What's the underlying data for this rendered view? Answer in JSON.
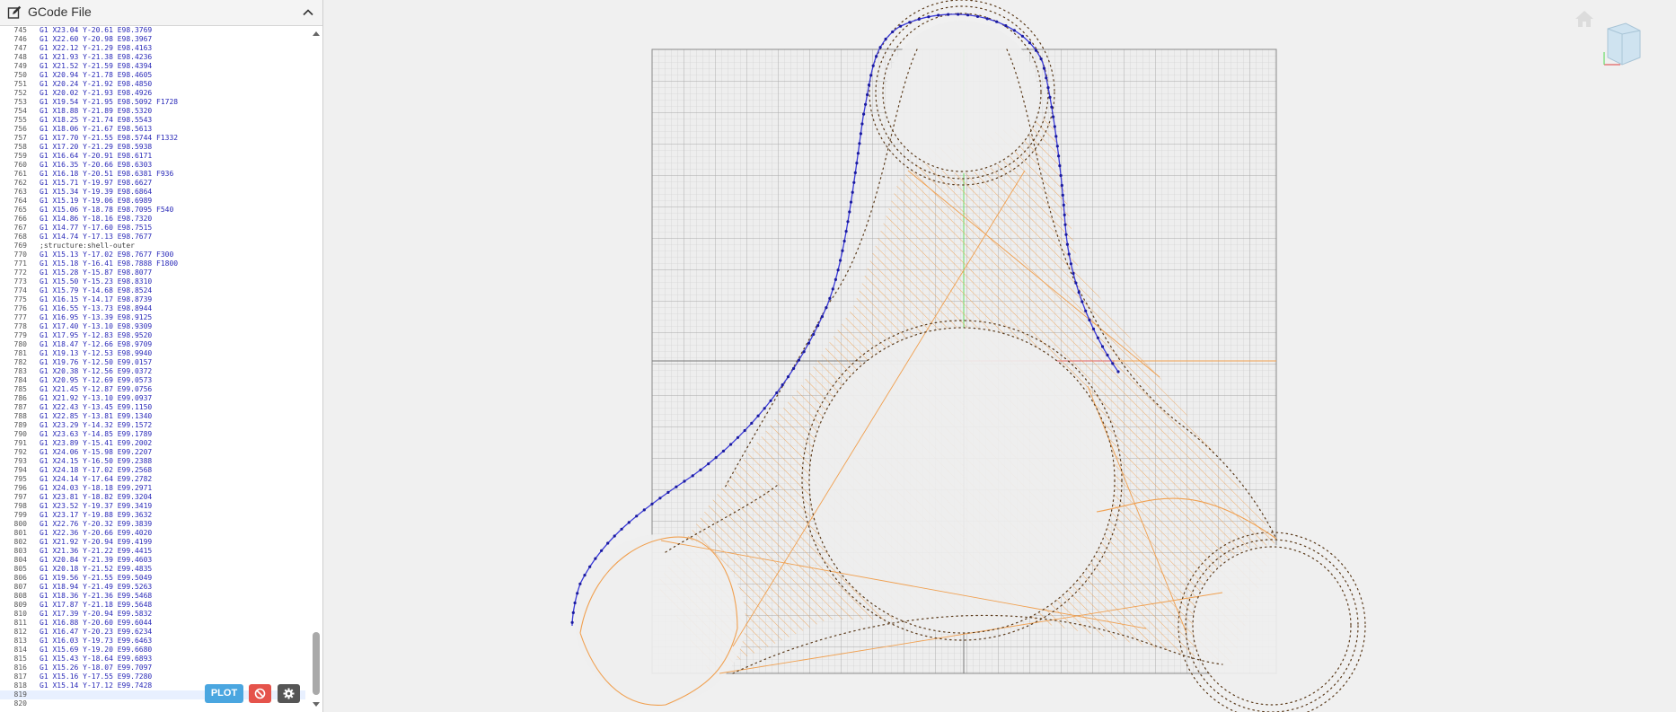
{
  "panel": {
    "title": "GCode File"
  },
  "buttons": {
    "plot_label": "PLOT"
  },
  "icons": {
    "edit": "edit-icon",
    "collapse": "chevron-up-icon",
    "stop": "ban-icon",
    "settings": "gear-icon",
    "home": "home-icon",
    "cube": "view-cube-icon"
  },
  "colors": {
    "gcode_text": "#2a2ab8",
    "plot_button": "#4aa6e0",
    "stop_button": "#e5534b",
    "settings_button": "#555555",
    "travel_path": "#3a3ad8",
    "infill": "#f0a050",
    "grid": "#c8c8c8",
    "y_axis": "#66dd66",
    "x_axis": "#e06060"
  },
  "gcode_lines": [
    {
      "n": "745",
      "t": "G1 X23.04 Y-20.61 E98.3769"
    },
    {
      "n": "746",
      "t": "G1 X22.60 Y-20.98 E98.3967"
    },
    {
      "n": "747",
      "t": "G1 X22.12 Y-21.29 E98.4163"
    },
    {
      "n": "748",
      "t": "G1 X21.93 Y-21.38 E98.4236"
    },
    {
      "n": "749",
      "t": "G1 X21.52 Y-21.59 E98.4394"
    },
    {
      "n": "750",
      "t": "G1 X20.94 Y-21.78 E98.4605"
    },
    {
      "n": "751",
      "t": "G1 X20.24 Y-21.92 E98.4850"
    },
    {
      "n": "752",
      "t": "G1 X20.02 Y-21.93 E98.4926"
    },
    {
      "n": "753",
      "t": "G1 X19.54 Y-21.95 E98.5092 F1728"
    },
    {
      "n": "754",
      "t": "G1 X18.88 Y-21.89 E98.5320"
    },
    {
      "n": "755",
      "t": "G1 X18.25 Y-21.74 E98.5543"
    },
    {
      "n": "756",
      "t": "G1 X18.06 Y-21.67 E98.5613"
    },
    {
      "n": "757",
      "t": "G1 X17.70 Y-21.55 E98.5744 F1332"
    },
    {
      "n": "758",
      "t": "G1 X17.20 Y-21.29 E98.5938"
    },
    {
      "n": "759",
      "t": "G1 X16.64 Y-20.91 E98.6171"
    },
    {
      "n": "760",
      "t": "G1 X16.35 Y-20.66 E98.6303"
    },
    {
      "n": "761",
      "t": "G1 X16.18 Y-20.51 E98.6381 F936"
    },
    {
      "n": "762",
      "t": "G1 X15.71 Y-19.97 E98.6627"
    },
    {
      "n": "763",
      "t": "G1 X15.34 Y-19.39 E98.6864"
    },
    {
      "n": "764",
      "t": "G1 X15.19 Y-19.06 E98.6989"
    },
    {
      "n": "765",
      "t": "G1 X15.06 Y-18.78 E98.7095 F540"
    },
    {
      "n": "766",
      "t": "G1 X14.86 Y-18.16 E98.7320"
    },
    {
      "n": "767",
      "t": "G1 X14.77 Y-17.60 E98.7515"
    },
    {
      "n": "768",
      "t": "G1 X14.74 Y-17.13 E98.7677"
    },
    {
      "n": "769",
      "t": ";structure:shell-outer"
    },
    {
      "n": "770",
      "t": "G1 X15.13 Y-17.02 E98.7677 F300"
    },
    {
      "n": "771",
      "t": "G1 X15.18 Y-16.41 E98.7888 F1800"
    },
    {
      "n": "772",
      "t": "G1 X15.28 Y-15.87 E98.8077"
    },
    {
      "n": "773",
      "t": "G1 X15.50 Y-15.23 E98.8310"
    },
    {
      "n": "774",
      "t": "G1 X15.79 Y-14.68 E98.8524"
    },
    {
      "n": "775",
      "t": "G1 X16.15 Y-14.17 E98.8739"
    },
    {
      "n": "776",
      "t": "G1 X16.55 Y-13.73 E98.8944"
    },
    {
      "n": "777",
      "t": "G1 X16.95 Y-13.39 E98.9125"
    },
    {
      "n": "778",
      "t": "G1 X17.40 Y-13.10 E98.9309"
    },
    {
      "n": "779",
      "t": "G1 X17.95 Y-12.83 E98.9520"
    },
    {
      "n": "780",
      "t": "G1 X18.47 Y-12.66 E98.9709"
    },
    {
      "n": "781",
      "t": "G1 X19.13 Y-12.53 E98.9940"
    },
    {
      "n": "782",
      "t": "G1 X19.76 Y-12.50 E99.0157"
    },
    {
      "n": "783",
      "t": "G1 X20.38 Y-12.56 E99.0372"
    },
    {
      "n": "784",
      "t": "G1 X20.95 Y-12.69 E99.0573"
    },
    {
      "n": "785",
      "t": "G1 X21.45 Y-12.87 E99.0756"
    },
    {
      "n": "786",
      "t": "G1 X21.92 Y-13.10 E99.0937"
    },
    {
      "n": "787",
      "t": "G1 X22.43 Y-13.45 E99.1150"
    },
    {
      "n": "788",
      "t": "G1 X22.85 Y-13.81 E99.1340"
    },
    {
      "n": "789",
      "t": "G1 X23.29 Y-14.32 E99.1572"
    },
    {
      "n": "790",
      "t": "G1 X23.63 Y-14.85 E99.1789"
    },
    {
      "n": "791",
      "t": "G1 X23.89 Y-15.41 E99.2002"
    },
    {
      "n": "792",
      "t": "G1 X24.06 Y-15.98 E99.2207"
    },
    {
      "n": "793",
      "t": "G1 X24.15 Y-16.50 E99.2388"
    },
    {
      "n": "794",
      "t": "G1 X24.18 Y-17.02 E99.2568"
    },
    {
      "n": "795",
      "t": "G1 X24.14 Y-17.64 E99.2782"
    },
    {
      "n": "796",
      "t": "G1 X24.03 Y-18.18 E99.2971"
    },
    {
      "n": "797",
      "t": "G1 X23.81 Y-18.82 E99.3204"
    },
    {
      "n": "798",
      "t": "G1 X23.52 Y-19.37 E99.3419"
    },
    {
      "n": "799",
      "t": "G1 X23.17 Y-19.88 E99.3632"
    },
    {
      "n": "800",
      "t": "G1 X22.76 Y-20.32 E99.3839"
    },
    {
      "n": "801",
      "t": "G1 X22.36 Y-20.66 E99.4020"
    },
    {
      "n": "802",
      "t": "G1 X21.92 Y-20.94 E99.4199"
    },
    {
      "n": "803",
      "t": "G1 X21.36 Y-21.22 E99.4415"
    },
    {
      "n": "804",
      "t": "G1 X20.84 Y-21.39 E99.4603"
    },
    {
      "n": "805",
      "t": "G1 X20.18 Y-21.52 E99.4835"
    },
    {
      "n": "806",
      "t": "G1 X19.56 Y-21.55 E99.5049"
    },
    {
      "n": "807",
      "t": "G1 X18.94 Y-21.49 E99.5263"
    },
    {
      "n": "808",
      "t": "G1 X18.36 Y-21.36 E99.5468"
    },
    {
      "n": "809",
      "t": "G1 X17.87 Y-21.18 E99.5648"
    },
    {
      "n": "810",
      "t": "G1 X17.39 Y-20.94 E99.5832"
    },
    {
      "n": "811",
      "t": "G1 X16.88 Y-20.60 E99.6044"
    },
    {
      "n": "812",
      "t": "G1 X16.47 Y-20.23 E99.6234"
    },
    {
      "n": "813",
      "t": "G1 X16.03 Y-19.73 E99.6463"
    },
    {
      "n": "814",
      "t": "G1 X15.69 Y-19.20 E99.6680"
    },
    {
      "n": "815",
      "t": "G1 X15.43 Y-18.64 E99.6893"
    },
    {
      "n": "816",
      "t": "G1 X15.26 Y-18.07 E99.7097"
    },
    {
      "n": "817",
      "t": "G1 X15.16 Y-17.55 E99.7280"
    },
    {
      "n": "818",
      "t": "G1 X15.14 Y-17.12 E99.7428"
    },
    {
      "n": "819",
      "t": ""
    },
    {
      "n": "820",
      "t": ""
    }
  ]
}
